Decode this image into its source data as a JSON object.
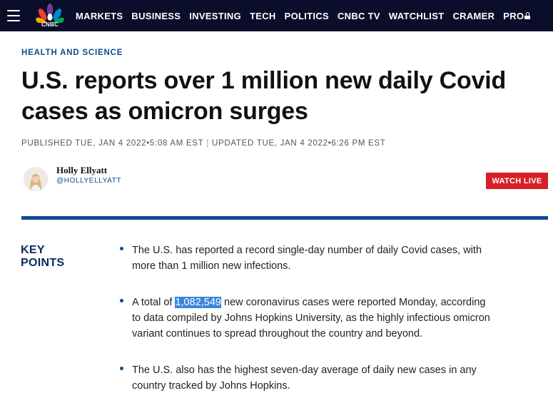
{
  "nav": {
    "logo_text": "CNBC",
    "items": [
      "MARKETS",
      "BUSINESS",
      "INVESTING",
      "TECH",
      "POLITICS",
      "CNBC TV",
      "WATCHLIST",
      "CRAMER",
      "PRO"
    ]
  },
  "article": {
    "section": "HEALTH AND SCIENCE",
    "headline": "U.S. reports over 1 million new daily Covid cases as omicron surges",
    "published": "PUBLISHED TUE, JAN 4 2022•5:08 AM EST",
    "separator": "|",
    "updated": "UPDATED TUE, JAN 4 2022•6:26 PM EST",
    "author": {
      "name": "Holly Ellyatt",
      "handle": "@HOLLYELLYATT"
    },
    "watch_live": "WATCH LIVE"
  },
  "key_points": {
    "heading_line1": "KEY",
    "heading_line2": "POINTS",
    "items": [
      {
        "text": "The U.S. has reported a record single-day number of daily Covid cases, with more than 1 million new infections."
      },
      {
        "before": "A total of ",
        "highlight": "1,082,549",
        "after": " new coronavirus cases were reported Monday, according to data compiled by Johns Hopkins University, as the highly infectious omicron variant continues to spread throughout the country and beyond."
      },
      {
        "text": "The U.S. also has the highest seven-day average of daily new cases in any country tracked by Johns Hopkins."
      }
    ]
  },
  "colors": {
    "nav_bg": "#0b0e2a",
    "accent_blue": "#0a4c8f",
    "live_red": "#d61f26",
    "selection": "#3a86d8"
  }
}
